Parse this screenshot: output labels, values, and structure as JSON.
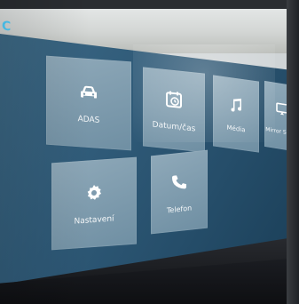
{
  "brand": {
    "logo_text": "C",
    "accent": "#4fd0ff"
  },
  "tiles": [
    {
      "label": "ADAS",
      "icon": "car-icon"
    },
    {
      "label": "Datum/čas",
      "icon": "calendar-clock-icon"
    },
    {
      "label": "Média",
      "icon": "music-note-icon"
    },
    {
      "label": "Mirror Scree",
      "icon": "mirror-screen-icon"
    },
    {
      "label": "Nastavení",
      "icon": "gear-icon"
    },
    {
      "label": "Telefon",
      "icon": "phone-icon"
    }
  ],
  "colors": {
    "screen_bg": "#2f5a78",
    "tile_bg": "#7f9bae",
    "dashboard": "#1d1f23"
  }
}
